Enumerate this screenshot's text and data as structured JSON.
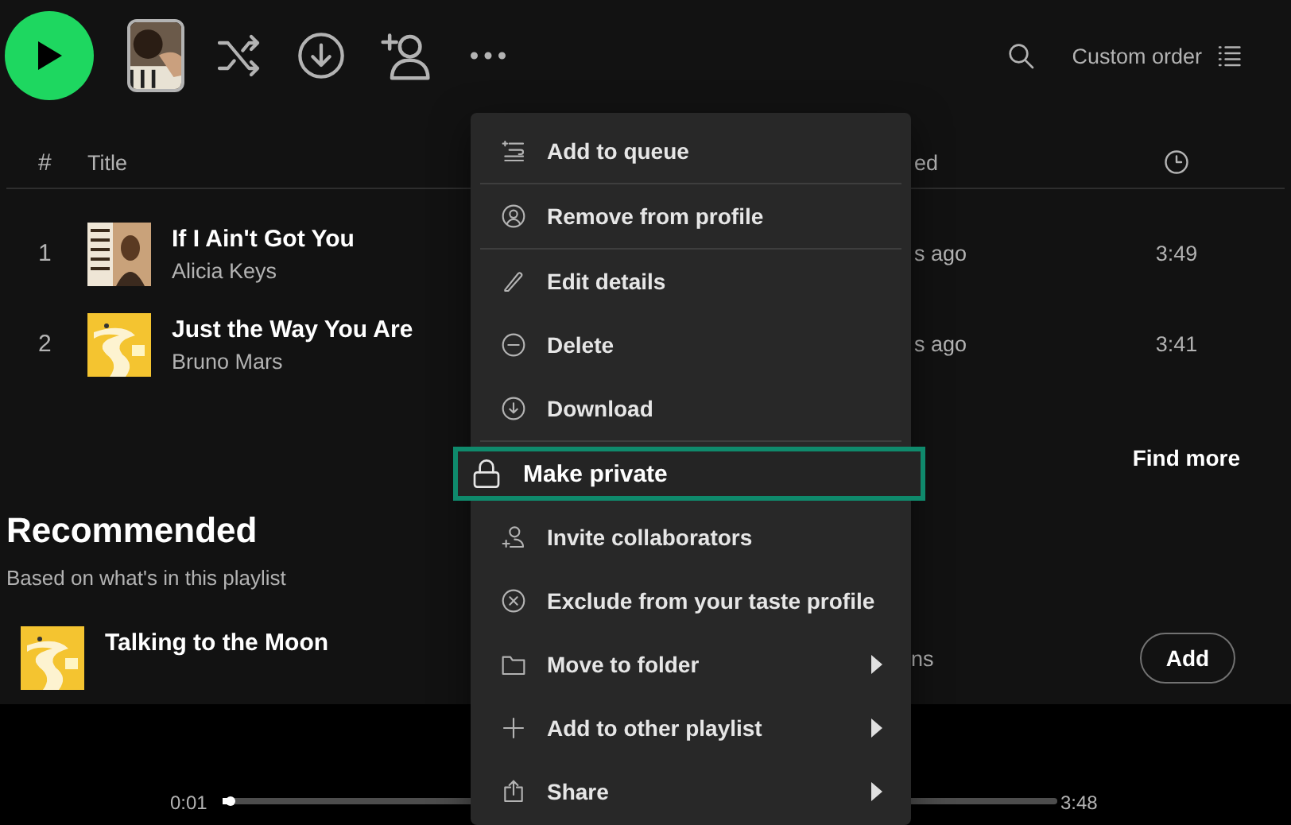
{
  "toolbar": {
    "sort_label": "Custom order"
  },
  "tracklist": {
    "header": {
      "number": "#",
      "title": "Title",
      "column_3": "ed"
    },
    "rows": [
      {
        "number": "1",
        "title": "If I Ain't Got You",
        "artist": "Alicia Keys",
        "column_3": "s ago",
        "duration": "3:49"
      },
      {
        "number": "2",
        "title": "Just the Way You Are",
        "artist": "Bruno Mars",
        "column_3": "s ago",
        "duration": "3:41"
      }
    ],
    "find_more": "Find more"
  },
  "recommended": {
    "heading": "Recommended",
    "subheading": "Based on what's in this playlist",
    "rows": [
      {
        "title": "Talking to the Moon",
        "column_3": "ns",
        "action": "Add"
      }
    ]
  },
  "player": {
    "elapsed": "0:01",
    "total": "3:48",
    "level": 0.01
  },
  "context_menu": {
    "groups": [
      [
        {
          "label": "Add to queue",
          "selected": false,
          "submenu": false
        }
      ],
      [
        {
          "label": "Remove from profile",
          "selected": false,
          "submenu": false
        }
      ],
      [
        {
          "label": "Edit details",
          "selected": false,
          "submenu": false
        },
        {
          "label": "Delete",
          "selected": false,
          "submenu": false
        },
        {
          "label": "Download",
          "selected": false,
          "submenu": false
        }
      ],
      [
        {
          "label": "Make private",
          "selected": true,
          "submenu": false
        },
        {
          "label": "Invite collaborators",
          "selected": false,
          "submenu": false
        },
        {
          "label": "Exclude from your taste profile",
          "selected": false,
          "submenu": false
        },
        {
          "label": "Move to folder",
          "selected": false,
          "submenu": true
        },
        {
          "label": "Add to other playlist",
          "selected": false,
          "submenu": true
        },
        {
          "label": "Share",
          "selected": false,
          "submenu": true
        }
      ]
    ]
  }
}
